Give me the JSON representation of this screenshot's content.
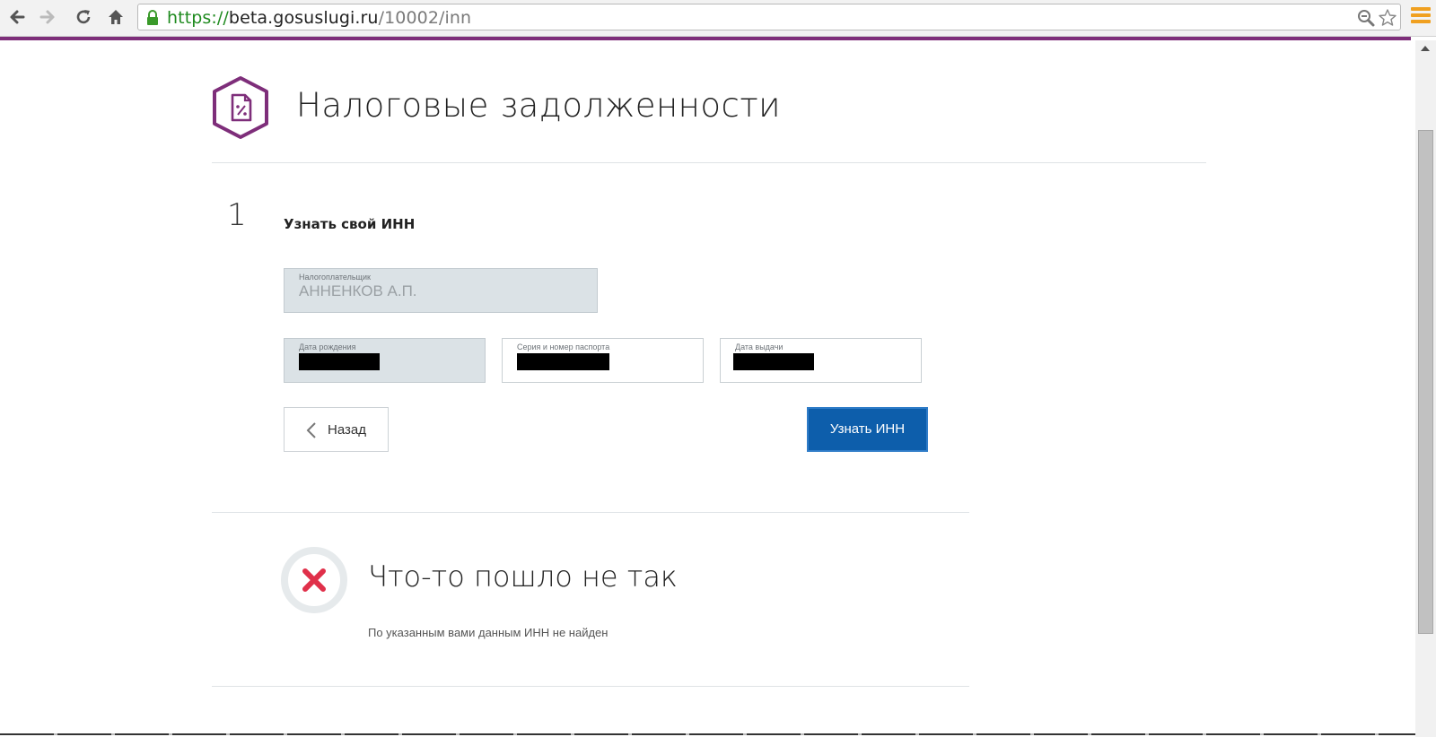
{
  "browser": {
    "url_scheme": "https://",
    "url_host": "beta.gosuslugi.ru",
    "url_path": "/10002/inn",
    "icons": {
      "back": "arrow-left-icon",
      "forward": "arrow-right-icon",
      "reload": "reload-icon",
      "home": "home-icon",
      "lock": "lock-icon",
      "zoom": "magnifier-icon",
      "bookmark": "star-icon",
      "menu": "hamburger-menu-icon"
    },
    "colors": {
      "secure": "#1e8a1e",
      "menu": "#f0a020",
      "strip": "#7e2e7a"
    }
  },
  "header": {
    "title": "Налоговые задолженности",
    "icon": "tax-document-percent-icon",
    "icon_color": "#7e2e7a"
  },
  "step": {
    "number": "1",
    "title": "Узнать свой ИНН"
  },
  "form": {
    "taxpayer": {
      "label": "Налогоплательщик",
      "value": "АННЕНКОВ А.П."
    },
    "birth_date": {
      "label": "Дата рождения"
    },
    "passport": {
      "label": "Серия и номер паспорта"
    },
    "issue_date": {
      "label": "Дата выдачи"
    }
  },
  "actions": {
    "back_label": "Назад",
    "submit_label": "Узнать ИНН",
    "primary_color": "#0d5eab"
  },
  "error": {
    "icon": "error-cross-icon",
    "title": "Что-то пошло не так",
    "message": "По указанным вами данным ИНН не найден",
    "icon_color": "#e0304a"
  }
}
